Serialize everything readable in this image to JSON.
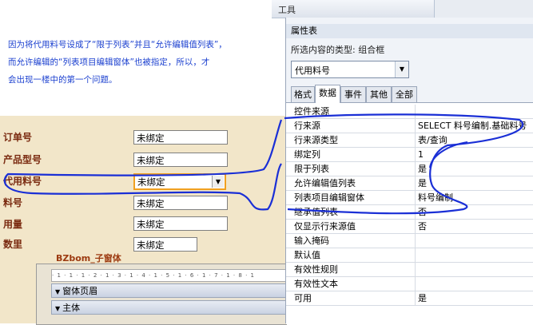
{
  "note": {
    "lines": [
      "因为将代用料号设成了“限于列表”并且“允许编辑值列表”，",
      "而允许编辑的“列表项目编辑窗体”也被指定，所以，才",
      "会出现一楼中的第一个问题。"
    ]
  },
  "toolbar": {
    "label": "工具"
  },
  "form": {
    "fields": [
      {
        "label": "订单号",
        "value": "未绑定"
      },
      {
        "label": "产品型号",
        "value": "未绑定"
      },
      {
        "label": "代用料号",
        "value": "未绑定"
      },
      {
        "label": "料号",
        "value": "未绑定"
      },
      {
        "label": "用量",
        "value": "未绑定"
      },
      {
        "label": "数里",
        "value": "未绑定"
      }
    ],
    "subform_label": "BZbom_子窗体",
    "ruler": "· 1 · 1 · 1 · 2 · 1 · 3 · 1 · 4 · 1 · 5 · 1 · 6 · 1 · 7 · 1 · 8 · 1",
    "sections": [
      "窗体页眉",
      "主体"
    ]
  },
  "props": {
    "title": "属性表",
    "selection_type_label": "所选内容的类型: 组合框",
    "selected_control": "代用料号",
    "tabs": [
      "格式",
      "数据",
      "事件",
      "其他",
      "全部"
    ],
    "active_tab": "数据",
    "rows": [
      {
        "key": "控件来源",
        "value": ""
      },
      {
        "key": "行来源",
        "value": "SELECT 料号编制.基础料号"
      },
      {
        "key": "行来源类型",
        "value": "表/查询"
      },
      {
        "key": "绑定列",
        "value": "1"
      },
      {
        "key": "限于列表",
        "value": "是"
      },
      {
        "key": "允许编辑值列表",
        "value": "是"
      },
      {
        "key": "列表项目编辑窗体",
        "value": "料号编制"
      },
      {
        "key": "继承值列表",
        "value": "否"
      },
      {
        "key": "仅显示行来源值",
        "value": "否"
      },
      {
        "key": "输入掩码",
        "value": ""
      },
      {
        "key": "默认值",
        "value": ""
      },
      {
        "key": "有效性规则",
        "value": ""
      },
      {
        "key": "有效性文本",
        "value": ""
      },
      {
        "key": "可用",
        "value": "是"
      }
    ]
  },
  "colors": {
    "annotation": "#1a2fd6",
    "highlight": "#f0a020",
    "label": "#7a2a10",
    "form_bg": "#f2e6c9"
  }
}
